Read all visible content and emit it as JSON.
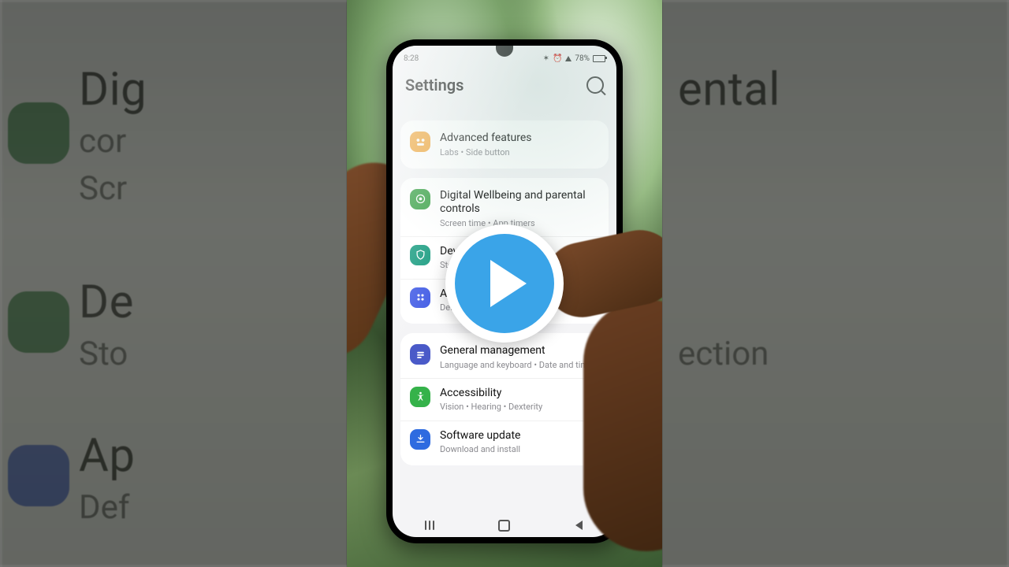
{
  "status": {
    "time": "8:28",
    "battery_pct": "78%",
    "battery_fill": 78
  },
  "header": {
    "title": "Settings"
  },
  "items": [
    {
      "id": "advanced",
      "icon": "orange",
      "title": "Advanced features",
      "sub": "Labs • Side button"
    },
    {
      "id": "wellbeing",
      "icon": "green",
      "title": "Digital Wellbeing and parental controls",
      "sub": "Screen time • App timers"
    },
    {
      "id": "device",
      "icon": "teal",
      "title": "Device care",
      "sub": "Storage • Memory • App protection"
    },
    {
      "id": "apps",
      "icon": "blue",
      "title": "Apps",
      "sub": "Default apps • App settings"
    },
    {
      "id": "general",
      "icon": "dblue",
      "title": "General management",
      "sub": "Language and keyboard • Date and time"
    },
    {
      "id": "access",
      "icon": "green2",
      "title": "Accessibility",
      "sub": "Vision • Hearing • Dexterity"
    },
    {
      "id": "update",
      "icon": "sblue",
      "title": "Software update",
      "sub": "Download and install"
    }
  ],
  "ghost": {
    "l1": "Dig",
    "l1s": "cor",
    "l1s2": "Scr",
    "l2": "De",
    "l2s": "Sto",
    "l3": "Ap",
    "l3s": "Def",
    "r1": "ental",
    "r2": "ection"
  }
}
